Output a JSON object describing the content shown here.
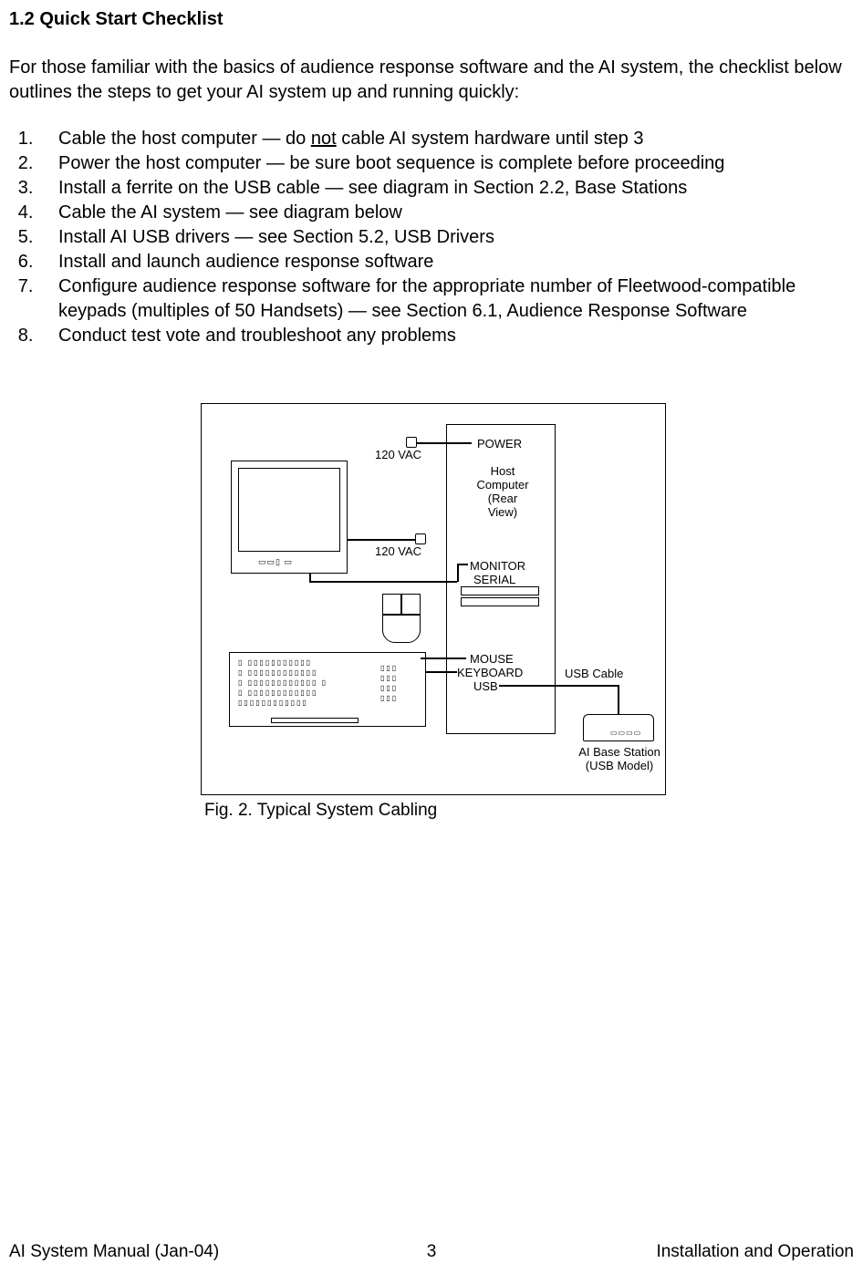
{
  "heading": "1.2  Quick Start Checklist",
  "intro": "For those familiar with the basics of audience response software and the AI system, the checklist below outlines the steps to get your AI system up and running quickly:",
  "list": {
    "i1a": "Cable the host computer — do ",
    "i1b": "not",
    "i1c": " cable AI system hardware until step 3",
    "i2": "Power the host computer — be sure boot sequence is complete before proceeding",
    "i3": "Install a ferrite on the USB cable — see diagram in Section 2.2, Base Stations",
    "i4": "Cable the AI system — see diagram below",
    "i5": "Install AI USB drivers — see Section 5.2, USB Drivers",
    "i6": "Install and launch audience response software",
    "i7": "Configure audience response software for the appropriate number of Fleetwood-compatible keypads (multiples of 50 Handsets) — see Section 6.1, Audience Response Software",
    "i8": "Conduct test vote and troubleshoot any problems"
  },
  "diagram": {
    "power": "POWER",
    "vac1": "120 VAC",
    "vac2": "120 VAC",
    "host1": "Host",
    "host2": "Computer",
    "host3": "(Rear View)",
    "monitor": "MONITOR",
    "serial": "SERIAL",
    "mouse": "MOUSE",
    "keyboard": "KEYBOARD",
    "usb": "USB",
    "usbcable": "USB Cable",
    "base1": "AI Base Station",
    "base2": "(USB Model)"
  },
  "caption": "Fig. 2.  Typical System Cabling",
  "footer": {
    "left": "AI System Manual (Jan-04)",
    "center": "3",
    "right": "Installation and Operation"
  }
}
